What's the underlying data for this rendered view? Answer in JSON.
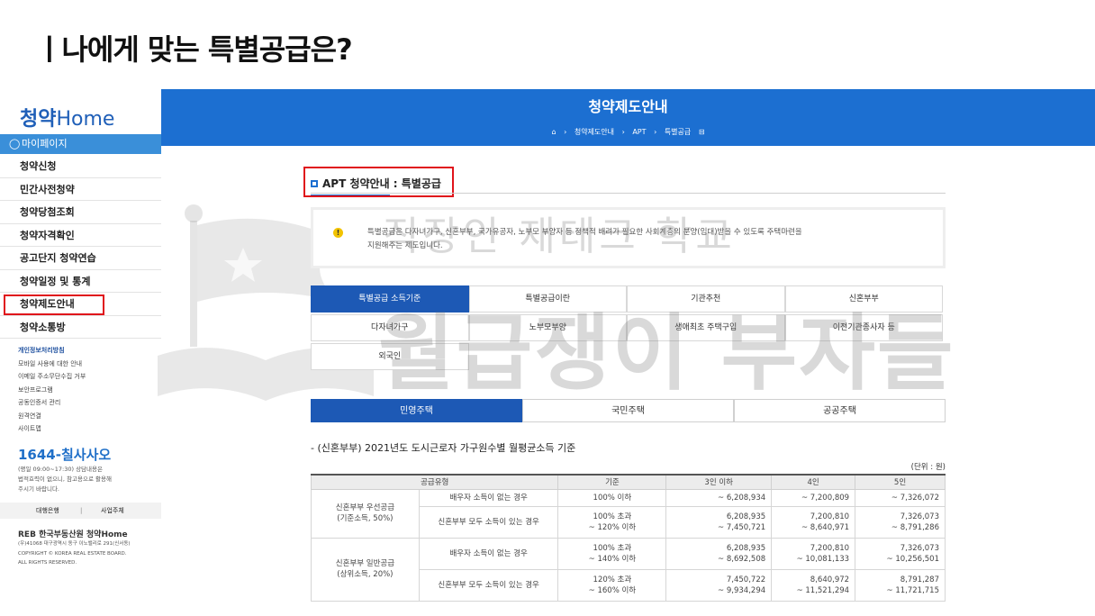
{
  "slide": {
    "title": "ㅣ나에게 맞는 특별공급은?"
  },
  "sidebar": {
    "logo_bold": "청약",
    "logo_rest": "Home",
    "mypage": "마이페이지",
    "menu": [
      {
        "label": "청약신청"
      },
      {
        "label": "민간사전청약"
      },
      {
        "label": "청약당첨조회"
      },
      {
        "label": "청약자격확인"
      },
      {
        "label": "공고단지 청약연습"
      },
      {
        "label": "청약일정 및 통계"
      },
      {
        "label": "청약제도안내"
      },
      {
        "label": "청약소통방"
      }
    ],
    "links": [
      {
        "label": "개인정보처리방침"
      },
      {
        "label": "모바일 사용에 대한 안내"
      },
      {
        "label": "이메일 주소무단수집 거부"
      },
      {
        "label": "보안프로그램"
      },
      {
        "label": "공동인증서 관리"
      },
      {
        "label": "원격연결"
      },
      {
        "label": "사이트맵"
      }
    ],
    "phone": "1644-칠사사오",
    "phone_desc_1": "(평일 09:00~17:30) 상담내용은",
    "phone_desc_2": "법적효력이 없으니, 참고용으로 활용해",
    "phone_desc_3": "주시기 바랍니다.",
    "bank": "대행은행",
    "biz": "사업주체",
    "footer_logo": "REB 한국부동산원 청약Home",
    "footer_addr": "(우)41068 대구광역시 동구 이노밸리로 291(신서동)",
    "footer_copy1": "COPYRIGHT © KOREA REAL ESTATE BOARD.",
    "footer_copy2": "ALL RIGHTS RESERVED."
  },
  "banner": {
    "title": "청약제도안내",
    "crumbs": [
      "청약제도안내",
      "APT",
      "특별공급"
    ],
    "home_icon": "⌂"
  },
  "section": {
    "title_pill": "APT 청약안내",
    "title_rest": " : 특별공급",
    "notice_1": "특별공급은 다자녀가구, 신혼부부, 국가유공자, 노부모 부양자 등 정책적 배려가 필요한 사회계층의 분양(임대)받을 수 있도록 주택마련을",
    "notice_2": "지원해주는 제도입니다."
  },
  "tabs": [
    {
      "label": "특별공급 소득기준"
    },
    {
      "label": "특별공급이란"
    },
    {
      "label": "기관추천"
    },
    {
      "label": "신혼부부"
    },
    {
      "label": "다자녀가구"
    },
    {
      "label": "노부모부양"
    },
    {
      "label": "생애최초 주택구입"
    },
    {
      "label": "이전기관종사자 등"
    },
    {
      "label": "외국인"
    }
  ],
  "segments": [
    {
      "label": "민영주택"
    },
    {
      "label": "국민주택"
    },
    {
      "label": "공공주택"
    }
  ],
  "table": {
    "caption": "- (신혼부부) 2021년도 도시근로자 가구원수별 월평균소득 기준",
    "unit": "(단위 : 원)",
    "headers": [
      "공급유형",
      "기준",
      "3인 이하",
      "4인",
      "5인"
    ],
    "groups": [
      {
        "cat_1": "신혼부부 우선공급",
        "cat_2": "(기준소득, 50%)"
      },
      {
        "cat_1": "신혼부부 일반공급",
        "cat_2": "(상위소득, 20%)"
      }
    ],
    "rows": [
      {
        "type": "배우자 소득이 없는 경우",
        "std_1": "100% 이하",
        "std_2": "",
        "c3_1": "~ 6,208,934",
        "c3_2": "",
        "c4_1": "~ 7,200,809",
        "c4_2": "",
        "c5_1": "~ 7,326,072",
        "c5_2": ""
      },
      {
        "type": "신혼부부 모두 소득이 있는 경우",
        "std_1": "100% 초과",
        "std_2": "~ 120% 이하",
        "c3_1": "6,208,935",
        "c3_2": "~ 7,450,721",
        "c4_1": "7,200,810",
        "c4_2": "~ 8,640,971",
        "c5_1": "7,326,073",
        "c5_2": "~ 8,791,286"
      },
      {
        "type": "배우자 소득이 없는 경우",
        "std_1": "100% 초과",
        "std_2": "~ 140% 이하",
        "c3_1": "6,208,935",
        "c3_2": "~ 8,692,508",
        "c4_1": "7,200,810",
        "c4_2": "~ 10,081,133",
        "c5_1": "7,326,073",
        "c5_2": "~ 10,256,501"
      },
      {
        "type": "신혼부부 모두 소득이 있는 경우",
        "std_1": "120% 초과",
        "std_2": "~ 160% 이하",
        "c3_1": "7,450,722",
        "c3_2": "~ 9,934,294",
        "c4_1": "8,640,972",
        "c4_2": "~ 11,521,294",
        "c5_1": "8,791,287",
        "c5_2": "~ 11,721,715"
      }
    ]
  },
  "watermark": {
    "line1": "직장인 재테크 학교",
    "line2": "월급쟁이 부자들"
  }
}
